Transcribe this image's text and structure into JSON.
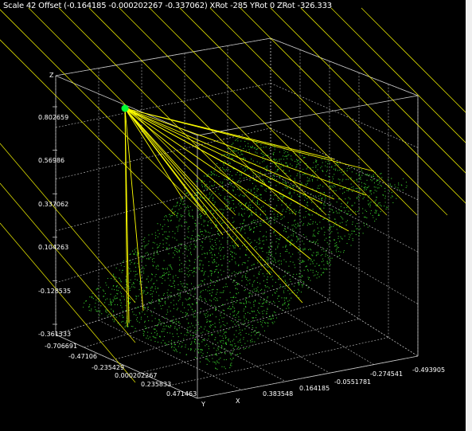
{
  "window": {
    "status_text": "Scale 42 Offset (-0.164185 -0.000202267 -0.337062) XRot -285 YRot 0 ZRot -326.333"
  },
  "view": {
    "scale": 42,
    "offset": [
      -0.164185,
      -0.000202267,
      -0.337062
    ],
    "rotation": {
      "x": -285,
      "y": 0,
      "z": -326.333
    }
  },
  "colors": {
    "background": "#000000",
    "grid": "#c8c8c8",
    "points": "#39d12b",
    "rays": "#ffff00",
    "source": "#00ff33",
    "text": "#ffffff"
  },
  "axes": {
    "z_title": "Z",
    "x_title": "X",
    "y_title": "Y",
    "z_ticks": [
      "0.802659",
      "0.56986",
      "0.337062",
      "0.104263",
      "-0.128535",
      "-0.361333"
    ],
    "y_ticks": [
      "-0.706691",
      "-0.47106",
      "-0.235429",
      "0.000202267",
      "0.235833",
      "0.471463"
    ],
    "x_ticks": [
      "-0.493905",
      "-0.274541",
      "-0.0551781",
      "0.164185",
      "0.383548"
    ]
  }
}
